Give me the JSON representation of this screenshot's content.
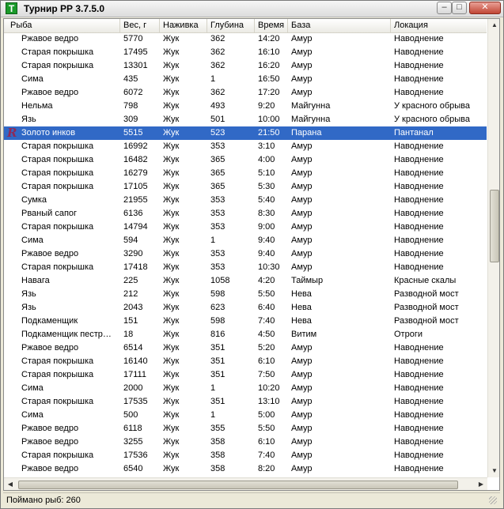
{
  "window": {
    "title": "Турнир РР 3.7.5.0",
    "app_icon": "T",
    "buttons": {
      "minimize": "–",
      "maximize": "□",
      "close": "✕"
    }
  },
  "table": {
    "columns": [
      "Рыба",
      "Вес, г",
      "Наживка",
      "Глубина",
      "Время",
      "База",
      "Локация"
    ],
    "rows": [
      [
        "Ржавое ведро",
        "5770",
        "Жук",
        "362",
        "14:20",
        "Амур",
        "Наводнение"
      ],
      [
        "Старая покрышка",
        "17495",
        "Жук",
        "362",
        "16:10",
        "Амур",
        "Наводнение"
      ],
      [
        "Старая покрышка",
        "13301",
        "Жук",
        "362",
        "16:20",
        "Амур",
        "Наводнение"
      ],
      [
        "Сима",
        "435",
        "Жук",
        "1",
        "16:50",
        "Амур",
        "Наводнение"
      ],
      [
        "Ржавое ведро",
        "6072",
        "Жук",
        "362",
        "17:20",
        "Амур",
        "Наводнение"
      ],
      [
        "Нельма",
        "798",
        "Жук",
        "493",
        "9:20",
        "Майгунна",
        "У красного обрыва"
      ],
      [
        "Язь",
        "309",
        "Жук",
        "501",
        "10:00",
        "Майгунна",
        "У красного обрыва"
      ],
      [
        "Золото инков",
        "5515",
        "Жук",
        "523",
        "21:50",
        "Парана",
        "Пантанал"
      ],
      [
        "Старая покрышка",
        "16992",
        "Жук",
        "353",
        "3:10",
        "Амур",
        "Наводнение"
      ],
      [
        "Старая покрышка",
        "16482",
        "Жук",
        "365",
        "4:00",
        "Амур",
        "Наводнение"
      ],
      [
        "Старая покрышка",
        "16279",
        "Жук",
        "365",
        "5:10",
        "Амур",
        "Наводнение"
      ],
      [
        "Старая покрышка",
        "17105",
        "Жук",
        "365",
        "5:30",
        "Амур",
        "Наводнение"
      ],
      [
        "Сумка",
        "21955",
        "Жук",
        "353",
        "5:40",
        "Амур",
        "Наводнение"
      ],
      [
        "Рваный сапог",
        "6136",
        "Жук",
        "353",
        "8:30",
        "Амур",
        "Наводнение"
      ],
      [
        "Старая покрышка",
        "14794",
        "Жук",
        "353",
        "9:00",
        "Амур",
        "Наводнение"
      ],
      [
        "Сима",
        "594",
        "Жук",
        "1",
        "9:40",
        "Амур",
        "Наводнение"
      ],
      [
        "Ржавое ведро",
        "3290",
        "Жук",
        "353",
        "9:40",
        "Амур",
        "Наводнение"
      ],
      [
        "Старая покрышка",
        "17418",
        "Жук",
        "353",
        "10:30",
        "Амур",
        "Наводнение"
      ],
      [
        "Навага",
        "225",
        "Жук",
        "1058",
        "4:20",
        "Таймыр",
        "Красные скалы"
      ],
      [
        "Язь",
        "212",
        "Жук",
        "598",
        "5:50",
        "Нева",
        "Разводной мост"
      ],
      [
        "Язь",
        "2043",
        "Жук",
        "623",
        "6:40",
        "Нева",
        "Разводной мост"
      ],
      [
        "Подкаменщик",
        "151",
        "Жук",
        "598",
        "7:40",
        "Нева",
        "Разводной мост"
      ],
      [
        "Подкаменщик пестр…",
        "18",
        "Жук",
        "816",
        "4:50",
        "Витим",
        "Отроги"
      ],
      [
        "Ржавое ведро",
        "6514",
        "Жук",
        "351",
        "5:20",
        "Амур",
        "Наводнение"
      ],
      [
        "Старая покрышка",
        "16140",
        "Жук",
        "351",
        "6:10",
        "Амур",
        "Наводнение"
      ],
      [
        "Старая покрышка",
        "17111",
        "Жук",
        "351",
        "7:50",
        "Амур",
        "Наводнение"
      ],
      [
        "Сима",
        "2000",
        "Жук",
        "1",
        "10:20",
        "Амур",
        "Наводнение"
      ],
      [
        "Старая покрышка",
        "17535",
        "Жук",
        "351",
        "13:10",
        "Амур",
        "Наводнение"
      ],
      [
        "Сима",
        "500",
        "Жук",
        "1",
        "5:00",
        "Амур",
        "Наводнение"
      ],
      [
        "Ржавое ведро",
        "6118",
        "Жук",
        "355",
        "5:50",
        "Амур",
        "Наводнение"
      ],
      [
        "Ржавое ведро",
        "3255",
        "Жук",
        "358",
        "6:10",
        "Амур",
        "Наводнение"
      ],
      [
        "Старая покрышка",
        "17536",
        "Жук",
        "358",
        "7:40",
        "Амур",
        "Наводнение"
      ],
      [
        "Ржавое ведро",
        "6540",
        "Жук",
        "358",
        "8:20",
        "Амур",
        "Наводнение"
      ]
    ],
    "selected_row": 7,
    "selected_marker": "R"
  },
  "status": {
    "text": "Поймано рыб: 260"
  },
  "colors": {
    "selection": "#3169c6",
    "marker": "#8e2a58",
    "app_icon": "#1a9a2a"
  }
}
